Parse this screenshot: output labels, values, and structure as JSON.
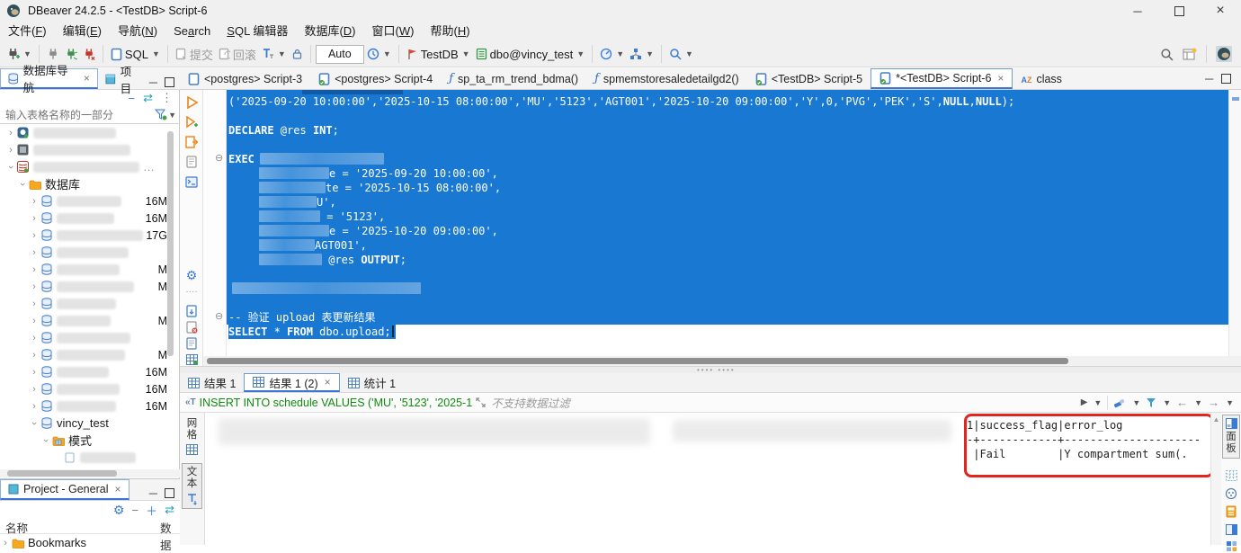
{
  "window": {
    "title": "DBeaver 24.2.5 - <TestDB> Script-6"
  },
  "menu": {
    "items": [
      {
        "label": "文件(F)",
        "u": 3
      },
      {
        "label": "编辑(E)",
        "u": 3
      },
      {
        "label": "导航(N)",
        "u": 3
      },
      {
        "label": "Search",
        "u": 2
      },
      {
        "label": "SQL 编辑器",
        "u": 0
      },
      {
        "label": "数据库(D)",
        "u": 4
      },
      {
        "label": "窗口(W)",
        "u": 3
      },
      {
        "label": "帮助(H)",
        "u": 3
      }
    ]
  },
  "toolbar": {
    "sql_label": "SQL",
    "commit_label": "提交",
    "rollback_label": "回滚",
    "autocommit_value": "Auto",
    "connection_value": "TestDB",
    "database_value": "dbo@vincy_test"
  },
  "editor_tabs": [
    {
      "label": "<postgres> Script-3",
      "icon": "sql"
    },
    {
      "label": "<postgres> Script-4",
      "icon": "sqlc"
    },
    {
      "label": "sp_ta_rm_trend_bdma()",
      "icon": "fn"
    },
    {
      "label": "spmemstoresaledetailgd2()",
      "icon": "fn"
    },
    {
      "label": "<TestDB> Script-5",
      "icon": "sqlc"
    },
    {
      "label": "*<TestDB> Script-6",
      "icon": "sqlc",
      "active": true,
      "close": true
    },
    {
      "label": "class",
      "icon": "az"
    }
  ],
  "navigator": {
    "tab_database": "数据库导航",
    "tab_project": "项目",
    "filter_placeholder": "输入表格名称的一部分",
    "tree": [
      {
        "type": "conn-postgres",
        "redacted": true
      },
      {
        "type": "conn-generic",
        "redacted": true
      },
      {
        "type": "conn-sqlserver",
        "redacted": true,
        "trail": "…"
      },
      {
        "type": "folder",
        "label": "数据库"
      },
      {
        "type": "database",
        "redacted": true,
        "size": "16M"
      },
      {
        "type": "database",
        "redacted": true,
        "size": "16M"
      },
      {
        "type": "database",
        "redacted": true,
        "size": "17G"
      },
      {
        "type": "database",
        "redacted": true,
        "size": ""
      },
      {
        "type": "database",
        "redacted": true,
        "size": "M"
      },
      {
        "type": "database",
        "redacted": true,
        "size": "M"
      },
      {
        "type": "database",
        "redacted": true,
        "size": ""
      },
      {
        "type": "database",
        "redacted": true,
        "size": "M"
      },
      {
        "type": "database",
        "redacted": true,
        "size": ""
      },
      {
        "type": "database",
        "redacted": true,
        "size": "M"
      },
      {
        "type": "database",
        "redacted": true,
        "size": "16M"
      },
      {
        "type": "database",
        "redacted": true,
        "size": "16M"
      },
      {
        "type": "database",
        "redacted": true,
        "size": "16M"
      },
      {
        "type": "database-open",
        "label": "vincy_test"
      },
      {
        "type": "schema-folder",
        "label": "模式"
      },
      {
        "type": "partial",
        "redacted": true
      }
    ]
  },
  "project_panel": {
    "tab": "Project - General",
    "col_name": "名称",
    "col_data": "数据",
    "items": [
      {
        "label": "Bookmarks"
      }
    ]
  },
  "editor": {
    "lines": [
      {
        "segs": [
          {
            "t": "('2025-09-20 10:00:00','2025-10-15 08:00:00','MU','5123','AGT001','2025-10-20 09:00:00','Y',0,'PVG','PEK','S',"
          },
          {
            "t": "NULL",
            "b": true
          },
          {
            "t": ","
          },
          {
            "t": "NULL",
            "b": true
          },
          {
            "t": ");"
          }
        ]
      },
      {
        "segs": []
      },
      {
        "segs": [
          {
            "t": "DECLARE",
            "b": true
          },
          {
            "t": " @res "
          },
          {
            "t": "INT",
            "b": true
          },
          {
            "t": ";"
          }
        ]
      },
      {
        "segs": []
      },
      {
        "fold": true,
        "segs": [
          {
            "t": "EXEC",
            "b": true
          },
          {
            "sp": 6
          },
          {
            "r": 138
          }
        ]
      },
      {
        "segs": [
          {
            "sp": 34
          },
          {
            "r": 78
          },
          {
            "t": "e = '2025-09-20 10:00:00',"
          }
        ]
      },
      {
        "segs": [
          {
            "sp": 34
          },
          {
            "r": 74
          },
          {
            "t": "te = '2025-10-15 08:00:00',"
          }
        ]
      },
      {
        "segs": [
          {
            "sp": 34
          },
          {
            "r": 64
          },
          {
            "t": "U',"
          }
        ]
      },
      {
        "segs": [
          {
            "sp": 34
          },
          {
            "r": 68
          },
          {
            "t": " = '5123',"
          }
        ]
      },
      {
        "segs": [
          {
            "sp": 34
          },
          {
            "r": 78
          },
          {
            "t": "e = '2025-10-20 09:00:00',"
          }
        ]
      },
      {
        "segs": [
          {
            "sp": 34
          },
          {
            "r": 62
          },
          {
            "t": "AGT001',"
          }
        ]
      },
      {
        "segs": [
          {
            "sp": 34
          },
          {
            "r": 70
          },
          {
            "t": " @res "
          },
          {
            "t": "OUTPUT",
            "b": true
          },
          {
            "t": ";"
          }
        ]
      },
      {
        "segs": []
      },
      {
        "segs": [
          {
            "sp": 4
          },
          {
            "r": 210
          }
        ]
      },
      {
        "segs": []
      },
      {
        "fold": true,
        "segs": [
          {
            "t": "-- 验证 upload 表更新结果"
          }
        ]
      },
      {
        "partial": true,
        "segs": [
          {
            "t": "SELECT",
            "b": true
          },
          {
            "t": " * "
          },
          {
            "t": "FROM",
            "b": true
          },
          {
            "t": " dbo.upload;"
          },
          {
            "cursor": true
          }
        ]
      }
    ]
  },
  "results": {
    "tabs": [
      {
        "label": "结果 1"
      },
      {
        "label": "结果 1 (2)",
        "active": true,
        "close": true
      },
      {
        "label": "统计 1"
      }
    ],
    "query": "INSERT INTO schedule VALUES ('MU', '5123', '2025-1",
    "filter_hint": "不支持数据过滤",
    "presentations": [
      {
        "label": "网格"
      },
      {
        "label": "文本",
        "active": true
      }
    ],
    "panels_label": "面板",
    "output_lines": [
      "1|success_flag|error_log",
      "-+------------+---------------------",
      " |Fail        |Y compartment sum(."
    ]
  },
  "colors": {
    "accent_blue": "#3875d7",
    "selection_blue": "#1878d2",
    "annotation_red": "#e5241d",
    "query_green": "#0e8a0e",
    "chrome_gray": "#f0f0f0"
  }
}
